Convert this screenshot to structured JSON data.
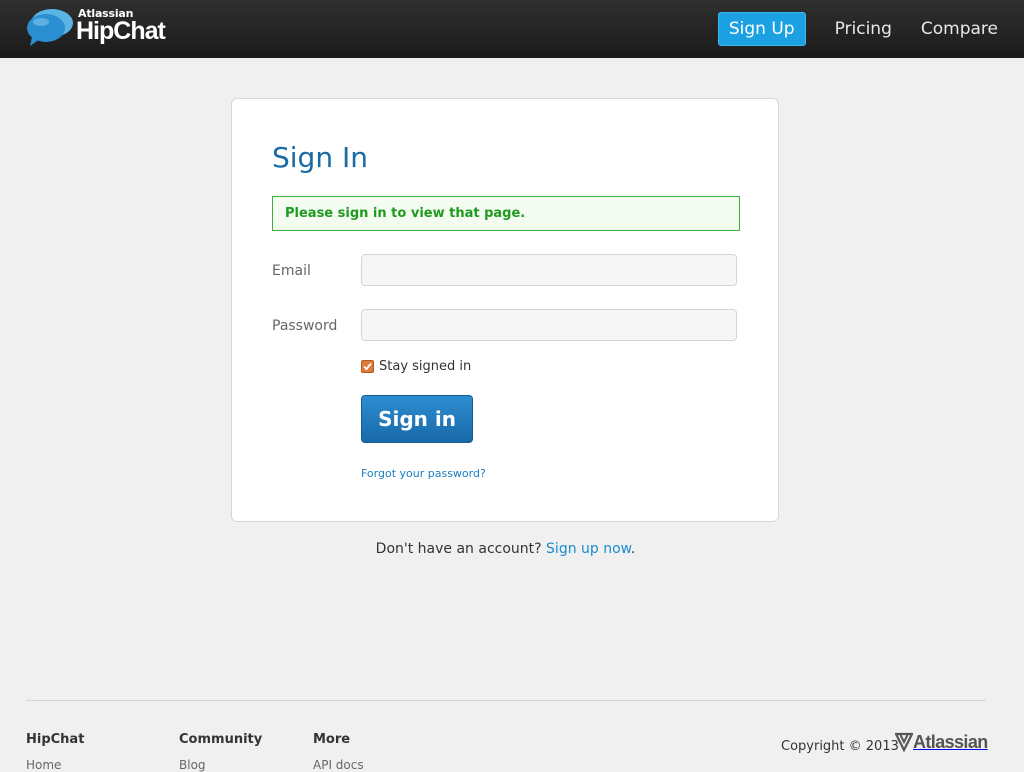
{
  "header": {
    "brand_small": "Atlassian",
    "brand_name": "HipChat",
    "nav": {
      "signup": "Sign Up",
      "pricing": "Pricing",
      "compare": "Compare"
    }
  },
  "signin": {
    "title": "Sign In",
    "notice": "Please sign in to view that page.",
    "email_label": "Email",
    "email_value": "",
    "password_label": "Password",
    "password_value": "",
    "remember_label": "Stay signed in",
    "remember_checked": true,
    "button_label": "Sign in",
    "forgot_link": "Forgot your password?"
  },
  "below_card": {
    "text": "Don't have an account?",
    "link": "Sign up now",
    "period": "."
  },
  "footer": {
    "columns": [
      {
        "heading": "HipChat",
        "first_link": "Home"
      },
      {
        "heading": "Community",
        "first_link": "Blog"
      },
      {
        "heading": "More",
        "first_link": "API docs"
      }
    ],
    "copyright": "Copyright © 2013",
    "atlassian_logo": "Atlassian"
  },
  "colors": {
    "header_bg": "#1b1b1b",
    "accent": "#1ba1e2",
    "title": "#1a6aa3",
    "notice_green": "#1e9a1e",
    "button_blue": "#1869a8"
  }
}
